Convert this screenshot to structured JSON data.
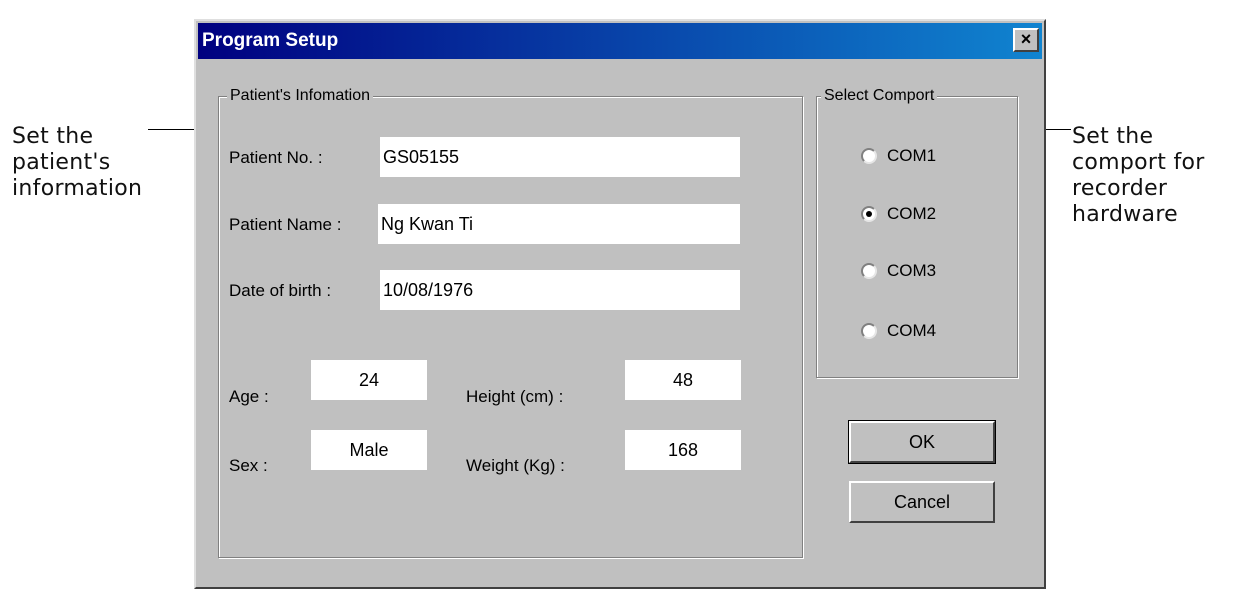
{
  "annotations": {
    "left": "Set the\npatient's\ninformation",
    "right": "Set the\ncomport for\nrecorder\nhardware"
  },
  "dialog": {
    "title": "Program Setup",
    "close_glyph": "×"
  },
  "patient_group": {
    "legend": "Patient's Infomation",
    "patient_no_label": "Patient No. :",
    "patient_no_value": "GS05155",
    "patient_name_label": "Patient Name :",
    "patient_name_value": "Ng Kwan Ti",
    "dob_label": "Date of birth :",
    "dob_value": "10/08/1976",
    "age_label": "Age :",
    "age_value": "24",
    "height_label": "Height (cm) :",
    "height_value": "48",
    "sex_label": "Sex :",
    "sex_value": "Male",
    "weight_label": "Weight (Kg) :",
    "weight_value": "168"
  },
  "comport_group": {
    "legend": "Select Comport",
    "options": [
      {
        "label": "COM1",
        "checked": false
      },
      {
        "label": "COM2",
        "checked": true
      },
      {
        "label": "COM3",
        "checked": false
      },
      {
        "label": "COM4",
        "checked": false
      }
    ]
  },
  "buttons": {
    "ok": "OK",
    "cancel": "Cancel"
  }
}
